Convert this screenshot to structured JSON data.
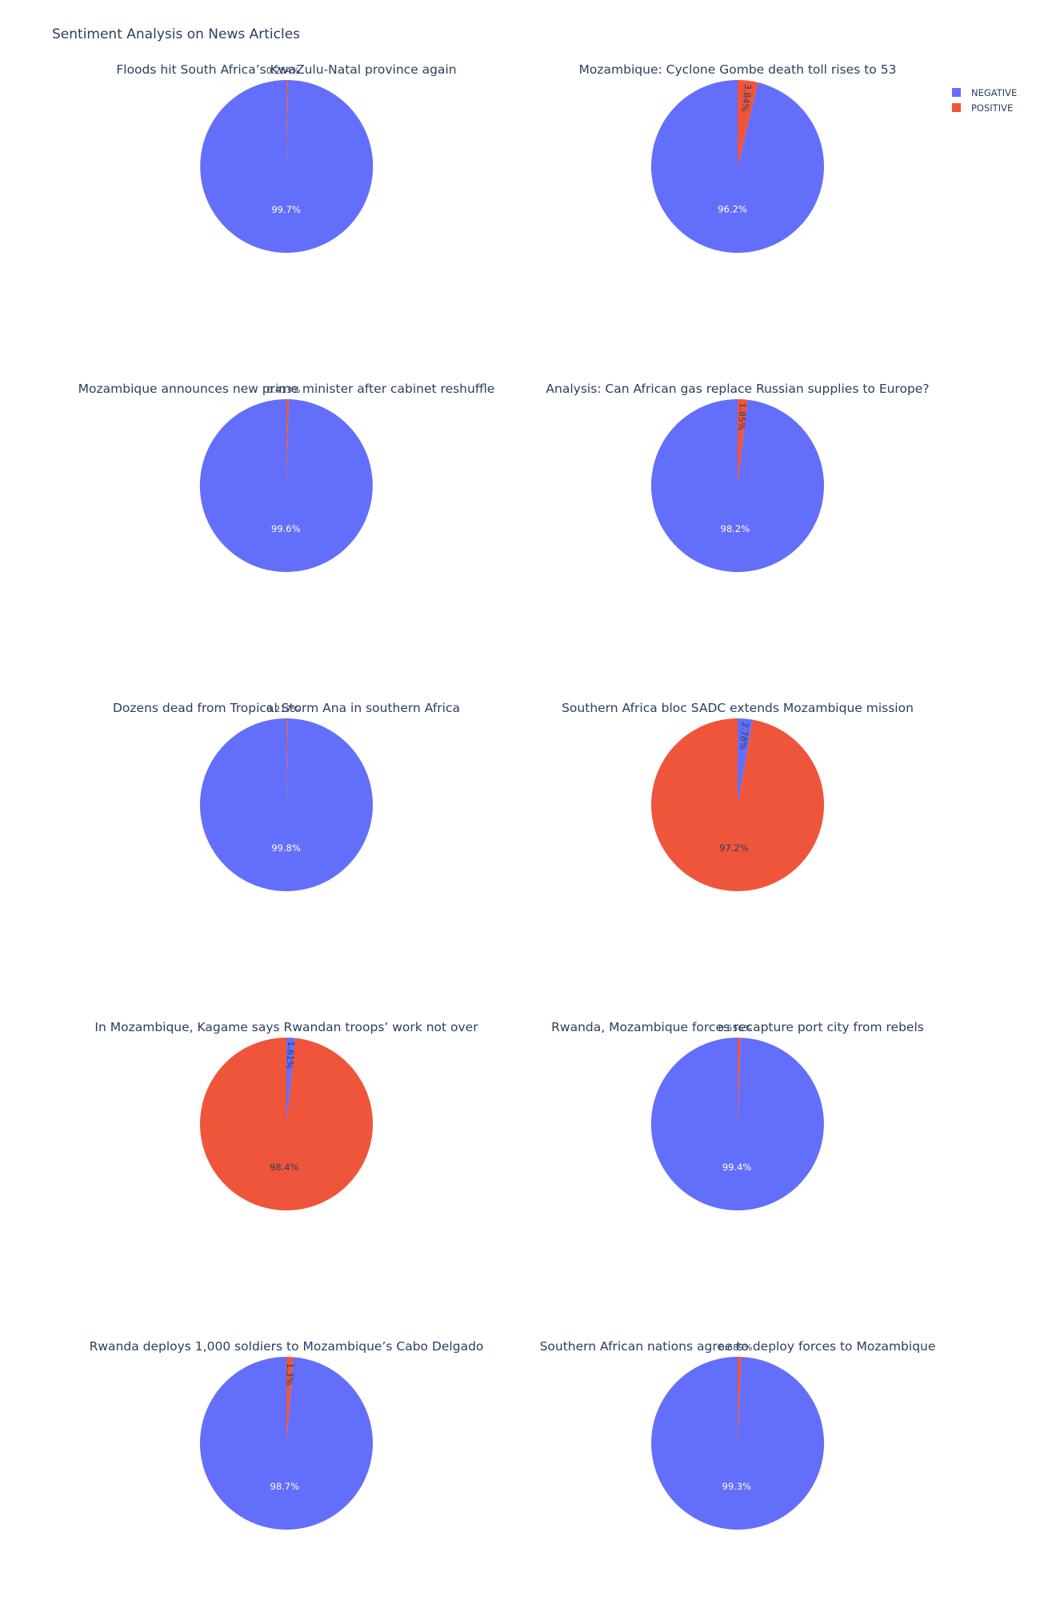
{
  "chart_data": {
    "type": "pie",
    "title": "Sentiment Analysis on News Articles",
    "legend": {
      "position": "top-right",
      "entries": [
        {
          "label": "NEGATIVE",
          "color": "#636efa"
        },
        {
          "label": "POSITIVE",
          "color": "#ef553b"
        }
      ]
    },
    "label_colors": {
      "light": "#ffffff",
      "dark": "#2a3f5f"
    },
    "charts": [
      {
        "title": "Floods hit South Africa’s KwaZulu-Natal province again",
        "slices": [
          {
            "label": "NEGATIVE",
            "value": 99.7,
            "text": "99.7%"
          },
          {
            "label": "POSITIVE",
            "value": 0.254,
            "text": "0.254%"
          }
        ]
      },
      {
        "title": "Mozambique: Cyclone Gombe death toll rises to 53",
        "slices": [
          {
            "label": "NEGATIVE",
            "value": 96.2,
            "text": "96.2%"
          },
          {
            "label": "POSITIVE",
            "value": 3.84,
            "text": "3.84%"
          }
        ]
      },
      {
        "title": "Mozambique announces new prime minister after cabinet reshuffle",
        "slices": [
          {
            "label": "NEGATIVE",
            "value": 99.6,
            "text": "99.6%"
          },
          {
            "label": "POSITIVE",
            "value": 0.413,
            "text": "0.413%"
          }
        ]
      },
      {
        "title": "Analysis: Can African gas replace Russian supplies to Europe?",
        "slices": [
          {
            "label": "NEGATIVE",
            "value": 98.2,
            "text": "98.2%"
          },
          {
            "label": "POSITIVE",
            "value": 1.85,
            "text": "1.85%"
          }
        ]
      },
      {
        "title": "Dozens dead from Tropical Storm Ana in southern Africa",
        "slices": [
          {
            "label": "NEGATIVE",
            "value": 99.8,
            "text": "99.8%"
          },
          {
            "label": "POSITIVE",
            "value": 0.217,
            "text": "0.217%"
          }
        ]
      },
      {
        "title": "Southern Africa bloc SADC extends Mozambique mission",
        "slices": [
          {
            "label": "POSITIVE",
            "value": 97.2,
            "text": "97.2%"
          },
          {
            "label": "NEGATIVE",
            "value": 2.78,
            "text": "2.78%"
          }
        ]
      },
      {
        "title": "In Mozambique, Kagame says Rwandan troops’ work not over",
        "slices": [
          {
            "label": "POSITIVE",
            "value": 98.4,
            "text": "98.4%"
          },
          {
            "label": "NEGATIVE",
            "value": 1.61,
            "text": "1.61%"
          }
        ]
      },
      {
        "title": "Rwanda, Mozambique forces recapture port city from rebels",
        "slices": [
          {
            "label": "NEGATIVE",
            "value": 99.4,
            "text": "99.4%"
          },
          {
            "label": "POSITIVE",
            "value": 0.556,
            "text": "0.556%"
          }
        ]
      },
      {
        "title": "Rwanda deploys 1,000 soldiers to Mozambique’s Cabo Delgado",
        "slices": [
          {
            "label": "NEGATIVE",
            "value": 98.7,
            "text": "98.7%"
          },
          {
            "label": "POSITIVE",
            "value": 1.3,
            "text": "1.3%"
          }
        ]
      },
      {
        "title": "Southern African nations agree to deploy forces to Mozambique",
        "slices": [
          {
            "label": "NEGATIVE",
            "value": 99.3,
            "text": "99.3%"
          },
          {
            "label": "POSITIVE",
            "value": 0.689,
            "text": "0.689%"
          }
        ]
      }
    ]
  }
}
